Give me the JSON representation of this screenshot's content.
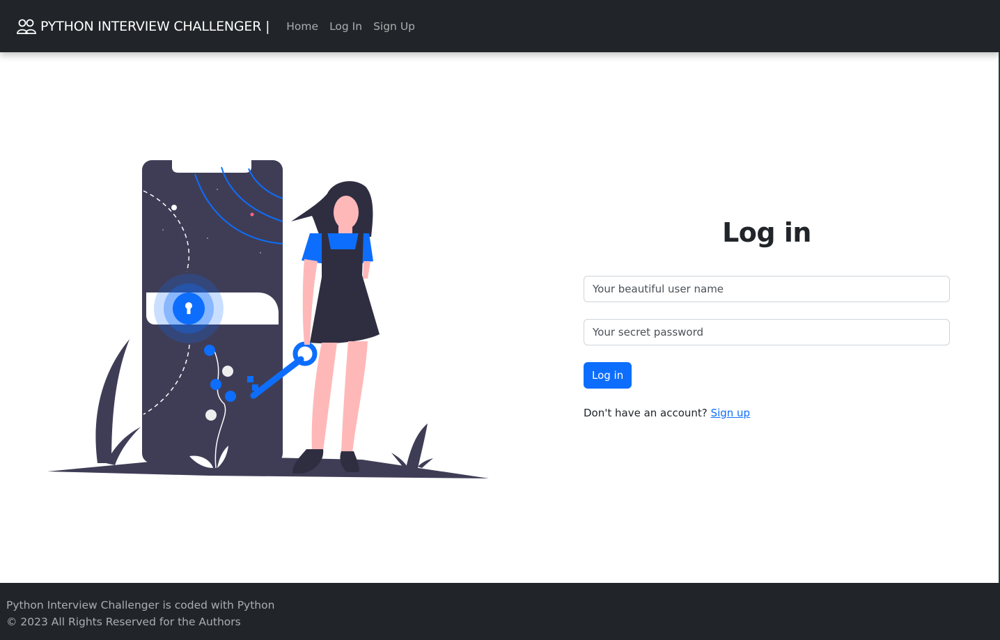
{
  "navbar": {
    "brand": "PYTHON INTERVIEW CHALLENGER |",
    "brand_icon": "people-icon",
    "links": [
      {
        "label": "Home"
      },
      {
        "label": "Log In"
      },
      {
        "label": "Sign Up"
      }
    ]
  },
  "login": {
    "title": "Log in",
    "username_placeholder": "Your beautiful user name",
    "password_placeholder": "Your secret password",
    "submit_label": "Log in",
    "signup_prompt": "Don't have an account?",
    "signup_link": "Sign up"
  },
  "footer": {
    "line1": "Python Interview Challenger is coded with Python",
    "line2": "© 2023 All Rights Reserved for the Authors"
  },
  "colors": {
    "navbar": "#212529",
    "primary": "#0d6efd",
    "illustration_dark": "#3f3d56",
    "illustration_skin": "#ffb8b8"
  }
}
